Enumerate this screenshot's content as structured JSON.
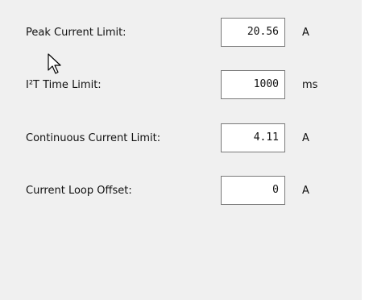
{
  "settings": {
    "rows": [
      {
        "label": "Peak Current Limit:",
        "value": "20.56",
        "unit": "A"
      },
      {
        "label": "I²T Time Limit:",
        "value": "1000",
        "unit": "ms"
      },
      {
        "label": "Continuous Current Limit:",
        "value": "4.11",
        "unit": "A"
      },
      {
        "label": "Current Loop Offset:",
        "value": "0",
        "unit": "A"
      }
    ]
  },
  "icons": {
    "pointer": "mouse-pointer-icon"
  },
  "colors": {
    "panel": "#f0f0f0",
    "field_border": "#7a7a7a"
  }
}
